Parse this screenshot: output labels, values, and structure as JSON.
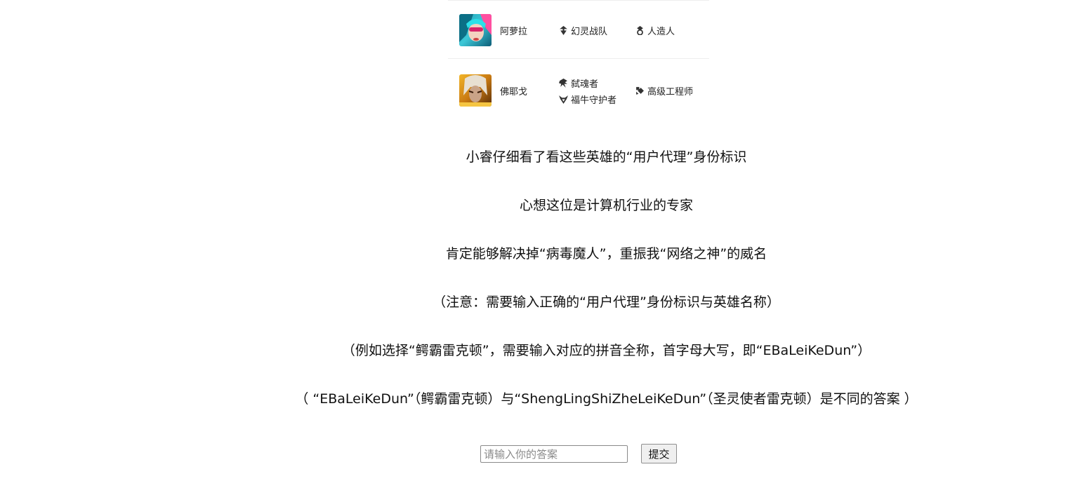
{
  "heroes": [
    {
      "name": "阿萝拉",
      "avatar_icon": "aurora-avatar",
      "origins": [
        {
          "icon": "phantom-squad-icon",
          "label": "幻灵战队"
        }
      ],
      "classes": [
        {
          "icon": "android-icon",
          "label": "人造人"
        }
      ]
    },
    {
      "name": "佛耶戈",
      "avatar_icon": "viego-avatar",
      "origins": [
        {
          "icon": "soulslayer-icon",
          "label": "弑魂者"
        },
        {
          "icon": "ox-guardian-icon",
          "label": "福牛守护者"
        }
      ],
      "classes": [
        {
          "icon": "senior-engineer-icon",
          "label": "高级工程师"
        }
      ]
    }
  ],
  "story": {
    "line1": "小睿仔细看了看这些英雄的“用户代理”身份标识",
    "line2": "心想这位是计算机行业的专家",
    "line3": "肯定能够解决掉“病毒魔人”，重振我“网络之神”的威名",
    "line4": "（注意：需要输入正确的“用户代理”身份标识与英雄名称）",
    "line5": "（例如选择“鳄霸雷克顿”，需要输入对应的拼音全称，首字母大写，即“EBaLeiKeDun”）",
    "line6": "（ “EBaLeiKeDun”（鳄霸雷克顿）与“ShengLingShiZheLeiKeDun”（圣灵使者雷克顿）是不同的答案 ）"
  },
  "form": {
    "placeholder": "请输入你的答案",
    "value": "",
    "submit_label": "提交"
  }
}
